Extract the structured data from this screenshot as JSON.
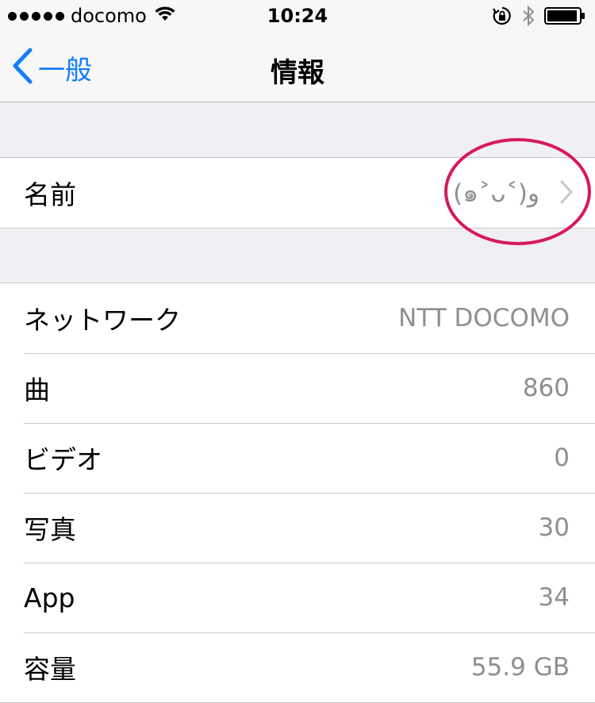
{
  "status_bar": {
    "carrier": "docomo",
    "time": "10:24",
    "signal_icon": "signal-dots-icon",
    "wifi_icon": "wifi-icon",
    "orientation_lock_icon": "orientation-lock-icon",
    "bluetooth_icon": "bluetooth-icon",
    "battery_icon": "battery-icon"
  },
  "nav": {
    "back_label": "一般",
    "title": "情報"
  },
  "name_row": {
    "label": "名前",
    "value": "(๑˃ᴗ˂)و"
  },
  "info_rows": [
    {
      "label": "ネットワーク",
      "value": "NTT DOCOMO"
    },
    {
      "label": "曲",
      "value": "860"
    },
    {
      "label": "ビデオ",
      "value": "0"
    },
    {
      "label": "写真",
      "value": "30"
    },
    {
      "label": "App",
      "value": "34"
    },
    {
      "label": "容量",
      "value": "55.9 GB"
    }
  ],
  "colors": {
    "accent": "#157efb",
    "highlight": "#d6195e",
    "secondary_text": "#8e8e93",
    "background": "#efeff4"
  }
}
